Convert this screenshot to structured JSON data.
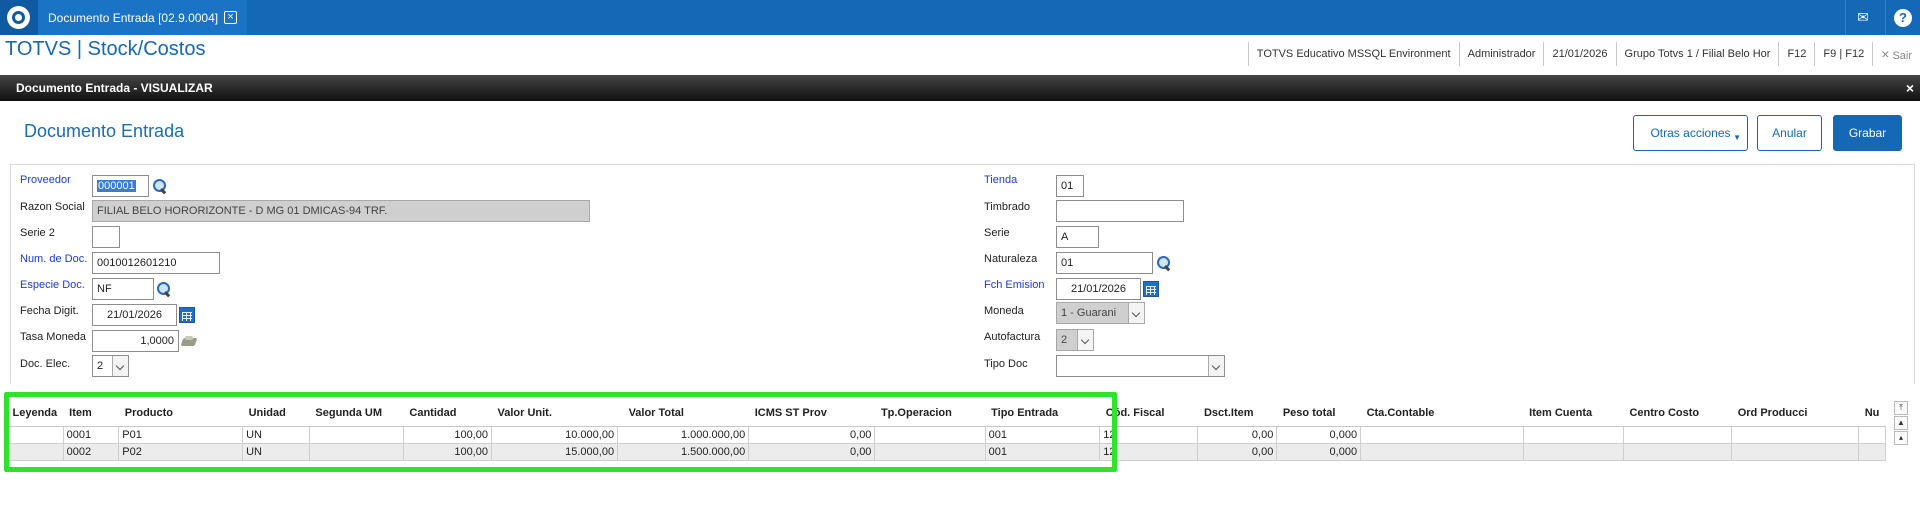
{
  "tab": {
    "title": "Documento Entrada [02.9.0004]",
    "close": "×"
  },
  "top_icons": {
    "mail": "✉",
    "help": "?"
  },
  "app": {
    "title": "TOTVS | Stock/Costos"
  },
  "status_bar": {
    "environment": "TOTVS Educativo MSSQL Environment",
    "user": "Administrador",
    "date": "21/01/2026",
    "branch": "Grupo Totvs 1 / Filial Belo Hor",
    "f12": "F12",
    "f9f12": "F9 | F12",
    "exit": "Sair",
    "exit_icon": "×"
  },
  "dialog": {
    "title": "Documento Entrada - VISUALIZAR",
    "close": "×"
  },
  "page": {
    "heading": "Documento Entrada"
  },
  "actions": {
    "otras": "Otras acciones",
    "anular": "Anular",
    "grabar": "Grabar"
  },
  "form": {
    "proveedor": {
      "label": "Proveedor",
      "value": "000001"
    },
    "razon_social": {
      "label": "Razon Social",
      "value": "FILIAL BELO HORORIZONTE - D MG 01 DMICAS-94 TRF."
    },
    "serie2": {
      "label": "Serie 2",
      "value": ""
    },
    "num_doc": {
      "label": "Num. de Doc.",
      "value": "0010012601210"
    },
    "especie": {
      "label": "Especie Doc.",
      "value": "NF"
    },
    "fecha_digit": {
      "label": "Fecha Digit.",
      "value": "21/01/2026"
    },
    "tasa_moneda": {
      "label": "Tasa Moneda",
      "value": "1,0000"
    },
    "doc_elec": {
      "label": "Doc. Elec.",
      "value": "2"
    },
    "tienda": {
      "label": "Tienda",
      "value": "01"
    },
    "timbrado": {
      "label": "Timbrado",
      "value": ""
    },
    "serie": {
      "label": "Serie",
      "value": "A"
    },
    "naturaleza": {
      "label": "Naturaleza",
      "value": "01"
    },
    "fch_emision": {
      "label": "Fch Emision",
      "value": "21/01/2026"
    },
    "moneda": {
      "label": "Moneda",
      "value": "1 - Guarani"
    },
    "autofactura": {
      "label": "Autofactura",
      "value": "2"
    },
    "tipo_doc": {
      "label": "Tipo Doc",
      "value": ""
    }
  },
  "grid": {
    "columns": [
      "Leyenda",
      "Item",
      "Producto",
      "Unidad",
      "Segunda UM",
      "Cantidad",
      "Valor Unit.",
      "Valor Total",
      "ICMS ST Prov",
      "Tp.Operacion",
      "Tipo Entrada",
      "Cód. Fiscal",
      "Dsct.Item",
      "Peso total",
      "Cta.Contable",
      "Item Cuenta",
      "Centro Costo",
      "Ord Producci",
      "Nu"
    ],
    "rows": [
      [
        "",
        "0001",
        "P01",
        "UN",
        "",
        "100,00",
        "10.000,00",
        "1.000.000,00",
        "0,00",
        "",
        "001",
        "12",
        "0,00",
        "0,000",
        "",
        "",
        "",
        "",
        ""
      ],
      [
        "",
        "0002",
        "P02",
        "UN",
        "",
        "100,00",
        "15.000,00",
        "1.500.000,00",
        "0,00",
        "",
        "001",
        "12",
        "0,00",
        "0,000",
        "",
        "",
        "",
        "",
        ""
      ]
    ]
  },
  "colors": {
    "accent": "#1468b5",
    "highlight": "#2fe22b",
    "link_label": "#1c3cd0"
  }
}
